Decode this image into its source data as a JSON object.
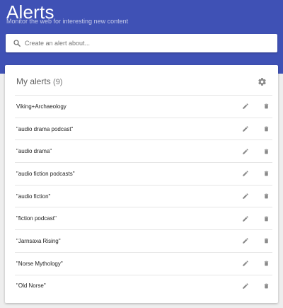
{
  "header": {
    "title": "Alerts",
    "subtitle": "Monitor the web for interesting new content"
  },
  "search": {
    "placeholder": "Create an alert about...",
    "icon": "search-icon"
  },
  "alerts_card": {
    "heading": "My alerts",
    "count": "(9)",
    "settings_icon": "gear-icon",
    "items": [
      {
        "label": "Viking+Archaeology"
      },
      {
        "label": "\"audio drama podcast\""
      },
      {
        "label": "\"audio drama\""
      },
      {
        "label": "\"audio fiction podcasts\""
      },
      {
        "label": "\"audio fiction\""
      },
      {
        "label": "\"fiction podcast\""
      },
      {
        "label": "\"Jarnsaxa Rising\""
      },
      {
        "label": "\"Norse Mythology\""
      },
      {
        "label": "\"Old Norse\""
      }
    ]
  },
  "colors": {
    "header_bg": "#3f51b5",
    "page_bg": "#eeeeee",
    "icon_gray": "#8a8a8a"
  }
}
